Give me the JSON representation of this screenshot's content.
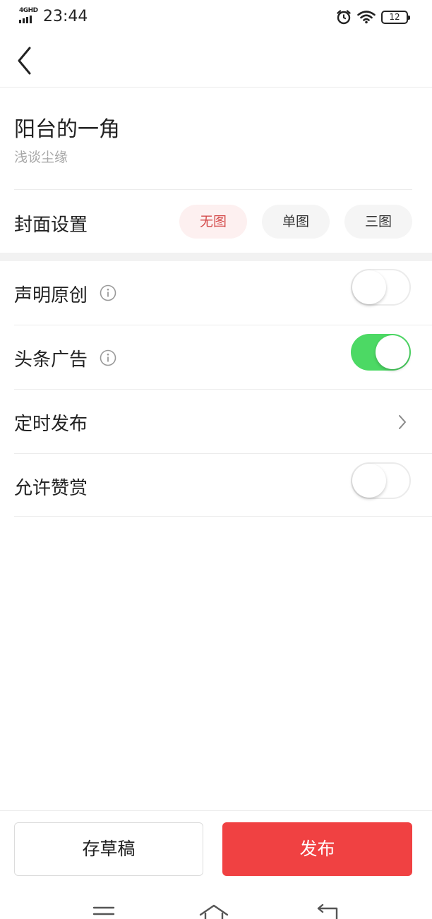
{
  "status_bar": {
    "network": "4GHD",
    "time": "23:44",
    "battery": "12",
    "icons": [
      "signal-icon",
      "alarm-clock-icon",
      "wifi-icon",
      "battery-icon"
    ]
  },
  "nav": {
    "back_icon": "chevron-left-icon"
  },
  "article": {
    "title": "阳台的一角",
    "author": "浅谈尘缘"
  },
  "cover": {
    "label": "封面设置",
    "options": [
      {
        "label": "无图",
        "selected": true
      },
      {
        "label": "单图",
        "selected": false
      },
      {
        "label": "三图",
        "selected": false
      }
    ]
  },
  "settings": [
    {
      "label": "声明原创",
      "info_icon": "info-icon",
      "control": "toggle",
      "on": false
    },
    {
      "label": "头条广告",
      "info_icon": "info-icon",
      "control": "toggle",
      "on": true
    },
    {
      "label": "定时发布",
      "control": "chevron",
      "icon": "chevron-right-icon"
    },
    {
      "label": "允许赞赏",
      "control": "toggle",
      "on": false
    }
  ],
  "bottom": {
    "draft_label": "存草稿",
    "publish_label": "发布"
  },
  "colors": {
    "accent_red": "#f04142",
    "selected_text": "#d44a4a",
    "selected_bg": "#fdf0f0",
    "toggle_on": "#4cd964",
    "muted_text": "#a8a8a8"
  },
  "system_nav": {
    "icons": [
      "menu-icon",
      "home-icon",
      "back-icon"
    ]
  }
}
